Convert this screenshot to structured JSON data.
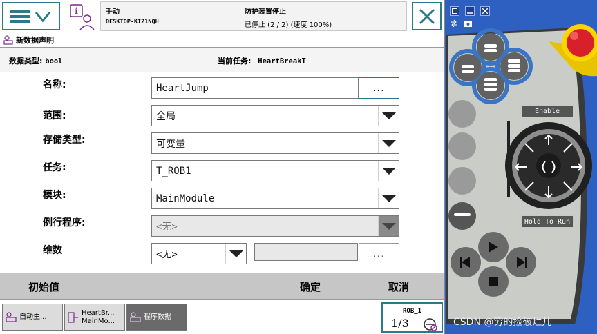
{
  "header": {
    "mode": "手动",
    "host": "DESKTOP-KI21NQH",
    "safety_status": "防护装置停止",
    "run_status": "已停止 (2 / 2) (速度 100%)"
  },
  "window": {
    "title": "新数据声明"
  },
  "info": {
    "type_label": "数据类型:",
    "type_value": "bool",
    "task_label": "当前任务:",
    "task_value": "HeartBreakT"
  },
  "form": {
    "name_label": "名称:",
    "name_value": "HeartJump",
    "name_btn": "...",
    "scope_label": "范围:",
    "scope_value": "全局",
    "storage_label": "存储类型:",
    "storage_value": "可变量",
    "task_label": "任务:",
    "task_value": "T_ROB1",
    "module_label": "模块:",
    "module_value": "MainModule",
    "routine_label": "例行程序:",
    "routine_value": "<无>",
    "dim_label": "维数",
    "dim_value": "<无>",
    "dim_btn": "..."
  },
  "commands": {
    "init": "初始值",
    "ok": "确定",
    "cancel": "取消"
  },
  "taskbar": {
    "t1": "自动生...",
    "t2_line1": "HeartBr...",
    "t2_line2": "MainMo...",
    "t3": "程序数据",
    "rob": "ROB_1",
    "fraction": "1/3"
  },
  "pendant": {
    "enable": "Enable",
    "hold": "Hold To Run",
    "watermark": "CSDN @穷的捡破烂儿"
  },
  "colors": {
    "accent": "#2a7a8c",
    "pendant_blue": "#2e60c2",
    "estop_red": "#d8202a",
    "estop_yellow": "#f2d200"
  }
}
